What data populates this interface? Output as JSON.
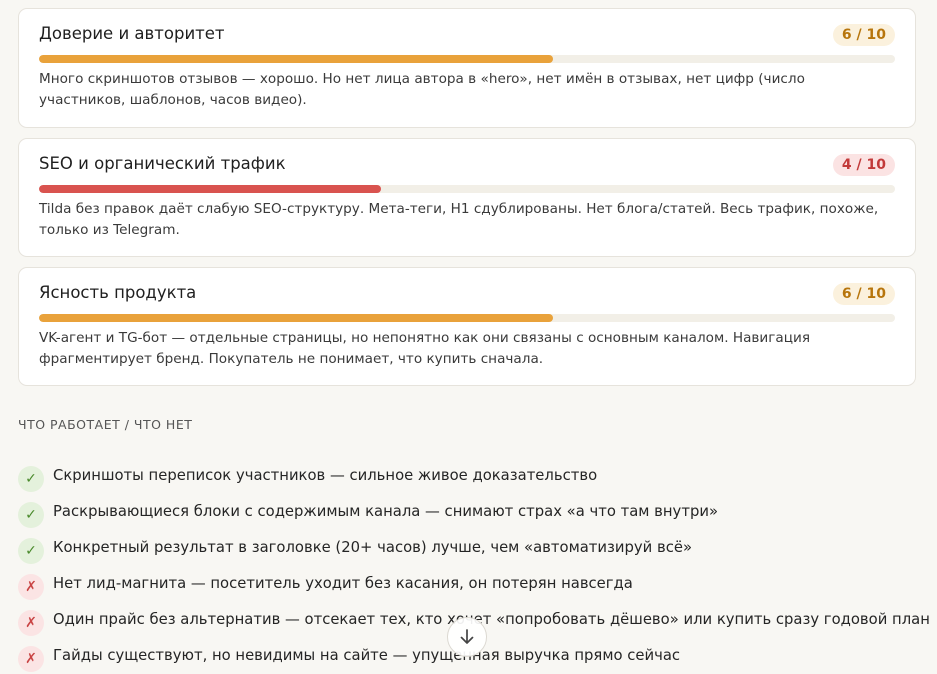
{
  "cards": [
    {
      "title": "Доверие и авторитет",
      "score": "6 / 10",
      "score_level": "mid",
      "progress": 0.6,
      "bar_color": "#e9a23b",
      "description": "Много скриншотов отзывов — хорошо. Но нет лица автора в «hero», нет имён в отзывах, нет цифр (число участников, шаблонов, часов видео)."
    },
    {
      "title": "SEO и органический трафик",
      "score": "4 / 10",
      "score_level": "low",
      "progress": 0.4,
      "bar_color": "#d9534f",
      "description": "Tilda без правок даёт слабую SEO-структуру. Мета-теги, H1 сдублированы. Нет блога/статей. Весь трафик, похоже, только из Telegram."
    },
    {
      "title": "Ясность продукта",
      "score": "6 / 10",
      "score_level": "mid",
      "progress": 0.6,
      "bar_color": "#e9a23b",
      "description": "VK-агент и TG-бот — отдельные страницы, но непонятно как они связаны с основным каналом. Навигация фрагментирует бренд. Покупатель не понимает, что купить сначала."
    }
  ],
  "section_label": "ЧТО РАБОТАЕТ / ЧТО НЕТ",
  "check_items": [
    {
      "status": "yes",
      "symbol": "✓",
      "text": "Скриншоты переписок участников — сильное живое доказательство"
    },
    {
      "status": "yes",
      "symbol": "✓",
      "text": "Раскрывающиеся блоки с содержимым канала — снимают страх «а что там внутри»"
    },
    {
      "status": "yes",
      "symbol": "✓",
      "text": "Конкретный результат в заголовке (20+ часов) лучше, чем «автоматизируй всё»"
    },
    {
      "status": "no",
      "symbol": "✗",
      "text": "Нет лид-магнита — посетитель уходит без касания, он потерян навсегда"
    },
    {
      "status": "no",
      "symbol": "✗",
      "text": "Один прайс без альтернатив — отсекает тех, кто хочет «попробовать дёшево» или купить сразу годовой план"
    },
    {
      "status": "no",
      "symbol": "✗",
      "text": "Гайды существуют, но невидимы на сайте — упущенная выручка прямо сейчас"
    }
  ],
  "scroll_button_icon": "arrow-down-icon"
}
